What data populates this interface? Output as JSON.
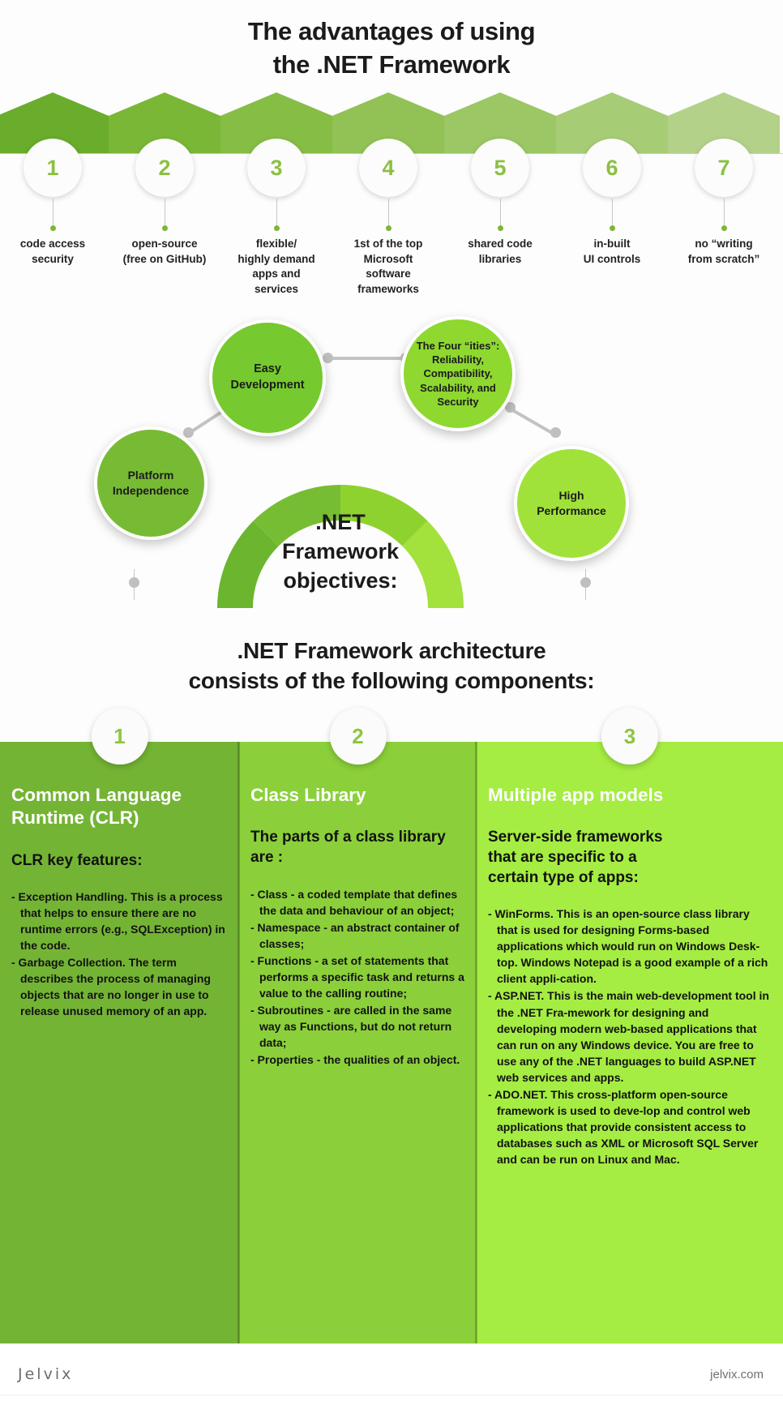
{
  "header": {
    "title_line1": "The advantages of using",
    "title_line2": "the .NET Framework"
  },
  "advantages": {
    "items": [
      {
        "number": "1",
        "label": "code access\nsecurity",
        "color": "#6aac2c"
      },
      {
        "number": "2",
        "label": "open-source\n(free on GitHub)",
        "color": "#7ab736"
      },
      {
        "number": "3",
        "label": "flexible/\nhighly demand\napps and\nservices",
        "color": "#86bd45"
      },
      {
        "number": "4",
        "label": "1st of the top\nMicrosoft\nsoftware\nframeworks",
        "color": "#92c255"
      },
      {
        "number": "5",
        "label": "shared code\nlibraries",
        "color": "#9cc765"
      },
      {
        "number": "6",
        "label": "in-built\nUI controls",
        "color": "#a7cc76"
      },
      {
        "number": "7",
        "label": "no “writing\nfrom scratch”",
        "color": "#b4d189"
      }
    ]
  },
  "objectives": {
    "center_text": ".NET\nFramework\nobjectives:",
    "bubbles": [
      {
        "id": "easy-development",
        "text": "Easy\nDevelopment",
        "color": "#76c92e"
      },
      {
        "id": "four-ities",
        "text": "The Four “ities”:\nReliability,\nCompatibility,\nScalability, and\nSecurity",
        "color": "#8ed82f"
      },
      {
        "id": "platform-independence",
        "text": "Platform\nIndependence",
        "color": "#77bb35"
      },
      {
        "id": "high-performance",
        "text": "High\nPerformance",
        "color": "#a0e23a"
      }
    ],
    "arc_colors": [
      "#6cb52f",
      "#77bd33",
      "#8ed230",
      "#a3e13c"
    ]
  },
  "architecture": {
    "title_line1": ".NET Framework architecture",
    "title_line2": "consists of the following components:",
    "columns": [
      {
        "number": "1",
        "title": "Common Language\nRuntime (CLR)",
        "subtitle": "CLR key features:",
        "bg": "#74b435",
        "items": [
          {
            "lead": "- Exception Handling.",
            "rest": " This is a process that helps to ensure there are no runtime errors (e.g., SQLException) in the code."
          },
          {
            "lead": "- Garbage Collection.",
            "rest": " The term describes the process of managing objects that are no longer in use to release unused memory of an app."
          }
        ]
      },
      {
        "number": "2",
        "title": "Class Library",
        "subtitle": "The parts of a class library\nare :",
        "bg": "#8bd03a",
        "items": [
          {
            "lead": "- Class",
            "rest": " - a coded template that defines the data and behaviour of an object;"
          },
          {
            "lead": "- Namespace",
            "rest": " - an abstract container of classes;"
          },
          {
            "lead": "- Functions",
            "rest": " - a set of statements that performs a specific task and returns a value to the calling routine;"
          },
          {
            "lead": "- Subroutines",
            "rest": " - are called in the same way as Functions, but do not return  data;"
          },
          {
            "lead": "- Properties",
            "rest": " - the qualities of an object."
          }
        ]
      },
      {
        "number": "3",
        "title": "Multiple app models",
        "subtitle": "Server-side frameworks\nthat are specific to a\ncertain type of apps:",
        "bg": "#a5ed42",
        "items": [
          {
            "lead": "- WinForms.",
            "rest": " This is an open-source class library that is used for designing Forms-based applications which would run on Windows Desk-top. Windows Notepad is a good example of a rich client appli-cation."
          },
          {
            "lead": "- ASP.NET.",
            "rest": " This is the main web-development tool in the .NET Fra-mework for designing and developing modern web-based applications that can run on any Windows device. You are free to use any of the .NET languages to build ASP.NET web services and apps."
          },
          {
            "lead": "- ADO.NET.",
            "rest": " This cross-platform open-source framework is used to deve-lop and control web applications that provide consistent access to databases such as XML or Microsoft SQL Server and can be run on Linux and Mac."
          }
        ]
      }
    ]
  },
  "footer": {
    "logo": "Jelvix",
    "url": "jelvix.com"
  }
}
